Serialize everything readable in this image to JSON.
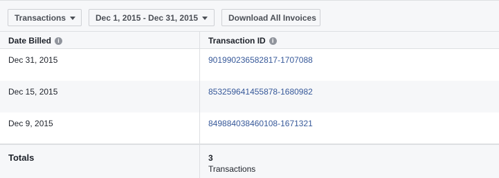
{
  "toolbar": {
    "transactions_label": "Transactions",
    "date_range_label": "Dec 1, 2015 - Dec 31, 2015",
    "download_label": "Download All Invoices"
  },
  "table": {
    "headers": {
      "date_billed": "Date Billed",
      "transaction_id": "Transaction ID"
    },
    "rows": [
      {
        "date": "Dec 31, 2015",
        "transaction_id": "901990236582817-1707088"
      },
      {
        "date": "Dec 15, 2015",
        "transaction_id": "853259641455878-1680982"
      },
      {
        "date": "Dec 9, 2015",
        "transaction_id": "849884038460108-1671321"
      }
    ],
    "totals": {
      "label": "Totals",
      "count": "3",
      "unit": "Transactions"
    }
  },
  "icons": {
    "caret": "chevron-down-icon",
    "info": "info-icon"
  },
  "colors": {
    "link": "#365899",
    "background_alt": "#f6f7f9",
    "border": "#dddfe2"
  }
}
